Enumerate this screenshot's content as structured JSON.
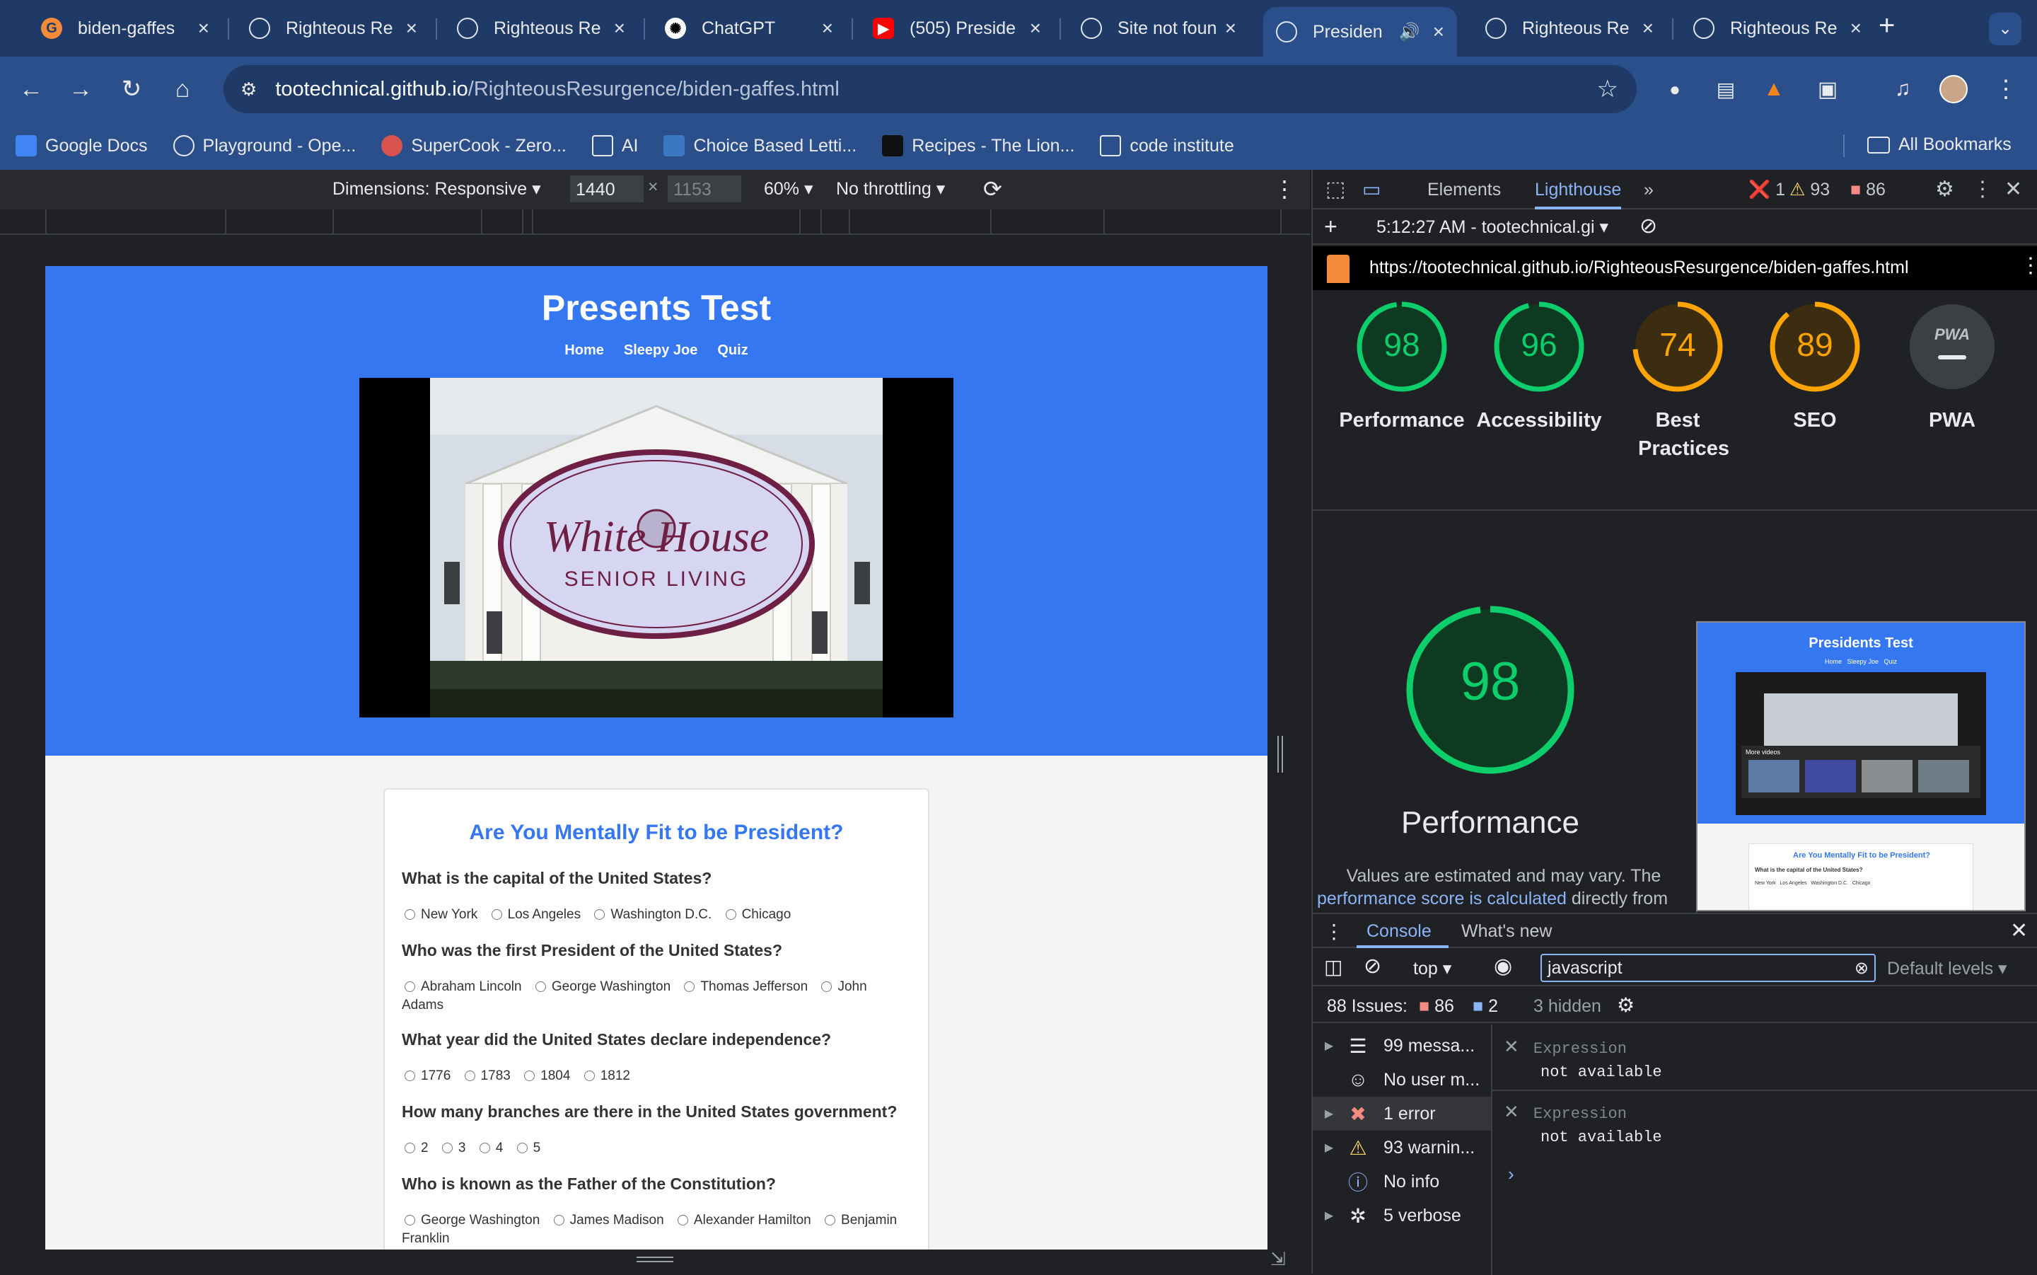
{
  "browser": {
    "tabs": [
      {
        "title": "biden-gaffes",
        "icon": "github-pages-icon"
      },
      {
        "title": "Righteous Re",
        "icon": "globe-icon"
      },
      {
        "title": "Righteous Re",
        "icon": "globe-icon"
      },
      {
        "title": "ChatGPT",
        "icon": "chatgpt-icon"
      },
      {
        "title": "(505) Preside",
        "icon": "youtube-icon"
      },
      {
        "title": "Site not foun",
        "icon": "globe-icon"
      },
      {
        "title": "Presiden",
        "icon": "globe-icon",
        "active": true
      },
      {
        "title": "Righteous Re",
        "icon": "globe-icon"
      },
      {
        "title": "Righteous Re",
        "icon": "globe-icon"
      }
    ],
    "url_host": "tootechnical.github.io",
    "url_path": "/RighteousResurgence/biden-gaffes.html",
    "bookmarks": [
      "Google Docs",
      "Playground - Ope...",
      "SuperCook - Zero...",
      "AI",
      "Choice Based Letti...",
      "Recipes - The Lion...",
      "code institute"
    ],
    "all_bookmarks": "All Bookmarks"
  },
  "device_toolbar": {
    "dimensions": "Dimensions: Responsive",
    "width": "1440",
    "height": "1153",
    "zoom": "60%",
    "throttle": "No throttling"
  },
  "page": {
    "title": "Presents Test",
    "nav": [
      "Home",
      "Sleepy Joe",
      "Quiz"
    ],
    "video_logo_top": "White House",
    "video_logo_bottom": "SENIOR LIVING",
    "quiz_title": "Are You Mentally Fit to be President?",
    "questions": [
      {
        "q": "What is the capital of the United States?",
        "options": [
          "New York",
          "Los Angeles",
          "Washington D.C.",
          "Chicago"
        ]
      },
      {
        "q": "Who was the first President of the United States?",
        "options": [
          "Abraham Lincoln",
          "George Washington",
          "Thomas Jefferson",
          "John Adams"
        ]
      },
      {
        "q": "What year did the United States declare independence?",
        "options": [
          "1776",
          "1783",
          "1804",
          "1812"
        ]
      },
      {
        "q": "How many branches are there in the United States government?",
        "options": [
          "2",
          "3",
          "4",
          "5"
        ]
      },
      {
        "q": "Who is known as the Father of the Constitution?",
        "options": [
          "George Washington",
          "James Madison",
          "Alexander Hamilton",
          "Benjamin Franklin"
        ]
      }
    ]
  },
  "devtools": {
    "tabs": [
      "Elements",
      "Lighthouse"
    ],
    "error_count": "1",
    "warning_count": "93",
    "issue_count": "86",
    "report_time": "5:12:27 AM - tootechnical.gi",
    "report_url": "https://tootechnical.github.io/RighteousResurgence/biden-gaffes.html",
    "scores": [
      {
        "label": "Performance",
        "value": 98,
        "color": "#0cce6b"
      },
      {
        "label": "Accessibility",
        "value": 96,
        "color": "#0cce6b"
      },
      {
        "label": "Best Practices",
        "value": 74,
        "color": "#ffa400"
      },
      {
        "label": "SEO",
        "value": 89,
        "color": "#ffa400"
      },
      {
        "label": "PWA",
        "value": null,
        "color": "#9aa0a6"
      }
    ],
    "pwa_badge": "PWA",
    "big_score": "98",
    "big_label": "Performance",
    "note_prefix": "Values are estimated and may vary. The",
    "note_link": "performance score is calculated",
    "note_suffix": "directly from",
    "thumb_title": "Presidents Test",
    "thumb_nav": "Home   Sleepy Joe   Quiz",
    "thumb_quiz_title": "Are You Mentally Fit to be President?",
    "thumb_q": "What is the capital of the United States?",
    "thumb_opts": "New York   Los Angeles   Washington D.C.   Chicago",
    "thumb_more": "More videos",
    "drawer_tabs": [
      "Console",
      "What's new"
    ],
    "context": "top",
    "filter": "javascript",
    "levels": "Default levels",
    "issues_label": "88 Issues:",
    "issues_a": "86",
    "issues_b": "2",
    "hidden": "3 hidden",
    "sidebar": [
      "99 messa...",
      "No user m...",
      "1 error",
      "93 warnin...",
      "No info",
      "5 verbose"
    ],
    "expr_label": "Expression",
    "expr_value": "not available"
  },
  "colors": {
    "hero": "#3477f0",
    "good": "#0cce6b",
    "average": "#ffa400"
  }
}
